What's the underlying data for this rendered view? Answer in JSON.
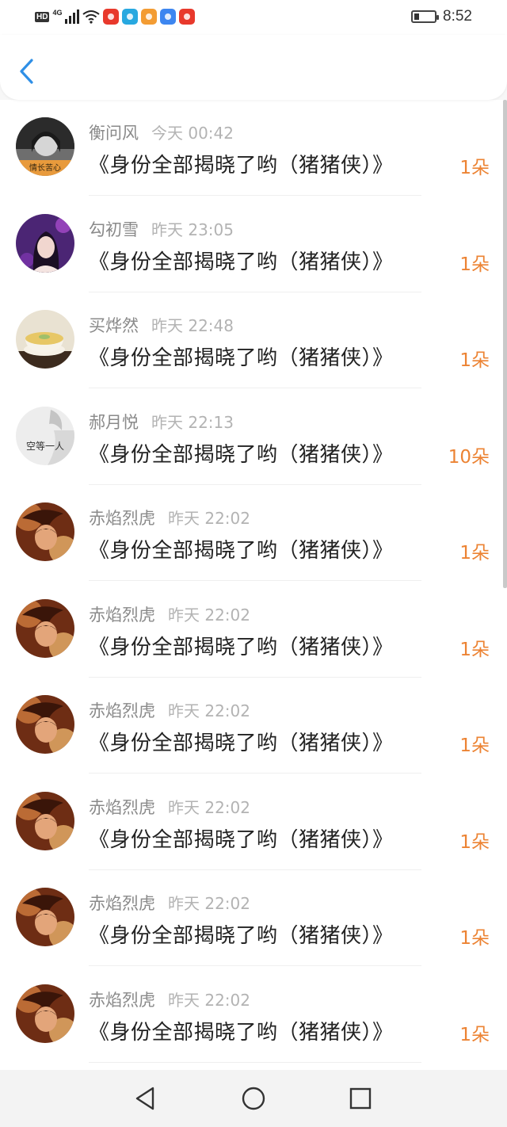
{
  "status_bar": {
    "hd_label": "HD",
    "network_label": "4G",
    "signal_bars": 4,
    "notification_icons": [
      {
        "icon": "weibo-icon",
        "color": "#e8392c"
      },
      {
        "icon": "reader-icon",
        "color": "#27a8e0"
      },
      {
        "icon": "video-icon",
        "color": "#f39c33"
      },
      {
        "icon": "phone-icon",
        "color": "#3d86f0"
      },
      {
        "icon": "weibo-icon",
        "color": "#e8392c"
      }
    ],
    "battery_level": 0.25,
    "time": "8:52"
  },
  "header": {
    "back_icon": "chevron-left-icon",
    "accent": "#2f8fe6"
  },
  "gifts": [
    {
      "user": "衡问风",
      "time": "今天 00:42",
      "title": "《身份全部揭晓了哟（猪猪侠）》",
      "count": "1朵",
      "avatar": {
        "style": "mono-portrait",
        "caption": "情长苦心"
      }
    },
    {
      "user": "勾初雪",
      "time": "昨天 23:05",
      "title": "《身份全部揭晓了哟（猪猪侠）》",
      "count": "1朵",
      "avatar": {
        "style": "purple-portrait"
      }
    },
    {
      "user": "买烨然",
      "time": "昨天 22:48",
      "title": "《身份全部揭晓了哟（猪猪侠）》",
      "count": "1朵",
      "avatar": {
        "style": "pudding"
      }
    },
    {
      "user": "郝月悦",
      "time": "昨天 22:13",
      "title": "《身份全部揭晓了哟（猪猪侠）》",
      "count": "10朵",
      "avatar": {
        "style": "gray-sketch",
        "caption": "空等一人"
      }
    },
    {
      "user": "赤焰烈虎",
      "time": "昨天 22:02",
      "title": "《身份全部揭晓了哟（猪猪侠）》",
      "count": "1朵",
      "avatar": {
        "style": "anime"
      }
    },
    {
      "user": "赤焰烈虎",
      "time": "昨天 22:02",
      "title": "《身份全部揭晓了哟（猪猪侠）》",
      "count": "1朵",
      "avatar": {
        "style": "anime"
      }
    },
    {
      "user": "赤焰烈虎",
      "time": "昨天 22:02",
      "title": "《身份全部揭晓了哟（猪猪侠）》",
      "count": "1朵",
      "avatar": {
        "style": "anime"
      }
    },
    {
      "user": "赤焰烈虎",
      "time": "昨天 22:02",
      "title": "《身份全部揭晓了哟（猪猪侠）》",
      "count": "1朵",
      "avatar": {
        "style": "anime"
      }
    },
    {
      "user": "赤焰烈虎",
      "time": "昨天 22:02",
      "title": "《身份全部揭晓了哟（猪猪侠）》",
      "count": "1朵",
      "avatar": {
        "style": "anime"
      }
    },
    {
      "user": "赤焰烈虎",
      "time": "昨天 22:02",
      "title": "《身份全部揭晓了哟（猪猪侠）》",
      "count": "1朵",
      "avatar": {
        "style": "anime"
      }
    }
  ],
  "colors": {
    "count": "#ec8333",
    "name": "#8a8a8a",
    "time": "#b3b3b3",
    "title": "#222222"
  },
  "nav": {
    "back": "triangle-back-icon",
    "home": "circle-home-icon",
    "recents": "square-recents-icon"
  }
}
